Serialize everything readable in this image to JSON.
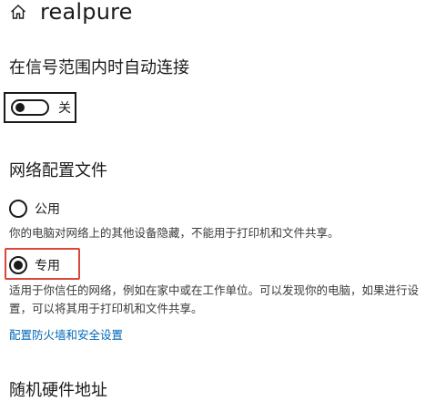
{
  "header": {
    "title": "realpure",
    "icon": "home-icon"
  },
  "auto_connect": {
    "title": "在信号范围内时自动连接",
    "toggle_state_label": "关",
    "toggle_on": false
  },
  "network_profile": {
    "title": "网络配置文件",
    "options": [
      {
        "label": "公用",
        "selected": false,
        "description": "你的电脑对网络上的其他设备隐藏，不能用于打印机和文件共享。"
      },
      {
        "label": "专用",
        "selected": true,
        "description": "适用于你信任的网络，例如在家中或在工作单位。可以发现你的电脑，如果进行设置，可以将其用于打印机和文件共享。"
      }
    ],
    "firewall_link": "配置防火墙和安全设置"
  },
  "mac_section": {
    "title": "随机硬件地址"
  },
  "colors": {
    "link": "#0067b8",
    "highlight": "#d9463a",
    "text": "#1a1a1a"
  }
}
